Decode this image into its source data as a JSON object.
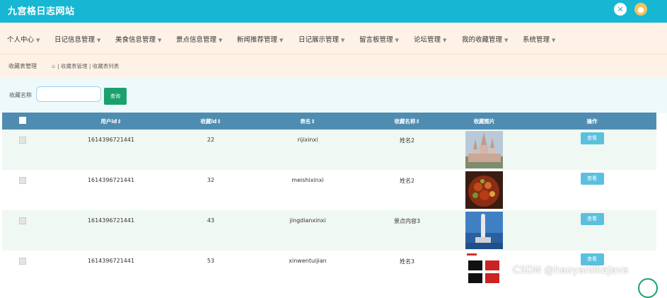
{
  "header": {
    "title": "九宫格日志网站"
  },
  "nav": {
    "items": [
      {
        "label": "个人中心"
      },
      {
        "label": "日记信息管理"
      },
      {
        "label": "美食信息管理"
      },
      {
        "label": "景点信息管理"
      },
      {
        "label": "新闻推荐管理"
      },
      {
        "label": "日记展示管理"
      },
      {
        "label": "留言板管理"
      },
      {
        "label": "论坛管理"
      },
      {
        "label": "我的收藏管理"
      },
      {
        "label": "系统管理"
      }
    ]
  },
  "breadcrumb": {
    "title": "收藏表管理",
    "path": "| 收藏表管理 | 收藏表列表"
  },
  "search": {
    "label": "收藏名称",
    "value": "",
    "button_label": "查询"
  },
  "table": {
    "headers": [
      "用户id⇕",
      "收藏id⇕",
      "表名⇕",
      "收藏名称⇕",
      "收藏图片",
      "操作"
    ],
    "rows": [
      {
        "user_id": "1614396721441",
        "fav_id": "22",
        "table_name": "rijixinxi",
        "fav_name": "姓名2",
        "image": "castle",
        "action": "查看"
      },
      {
        "user_id": "1614396721441",
        "fav_id": "32",
        "table_name": "meishixinxi",
        "fav_name": "姓名2",
        "image": "food",
        "action": "查看"
      },
      {
        "user_id": "1614396721441",
        "fav_id": "43",
        "table_name": "jingdianxinxi",
        "fav_name": "景点内容3",
        "image": "statue",
        "action": "查看"
      },
      {
        "user_id": "1614396721441",
        "fav_id": "53",
        "table_name": "xinwentuijian",
        "fav_name": "姓名3",
        "image": "news",
        "action": "查看"
      }
    ]
  },
  "overlay": {
    "watermark": "CSDN @haoyanlikeJava"
  },
  "colors": {
    "topbar": "#17b7d3",
    "nav_bg": "#fef2e6",
    "table_header": "#4e8db1",
    "search_button": "#1aa16e",
    "view_button": "#5bc0de"
  }
}
